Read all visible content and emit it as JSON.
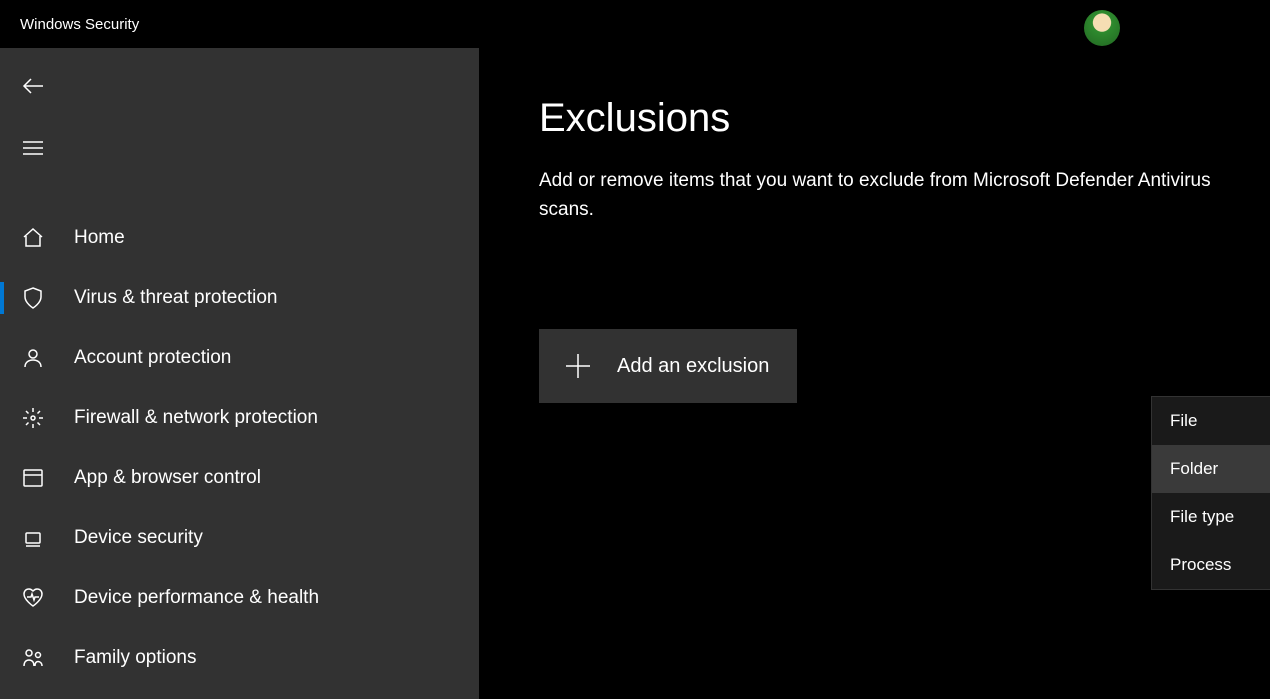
{
  "window": {
    "title": "Windows Security"
  },
  "sidebar": {
    "items": [
      {
        "label": "Home"
      },
      {
        "label": "Virus & threat protection"
      },
      {
        "label": "Account protection"
      },
      {
        "label": "Firewall & network protection"
      },
      {
        "label": "App & browser control"
      },
      {
        "label": "Device security"
      },
      {
        "label": "Device performance & health"
      },
      {
        "label": "Family options"
      }
    ],
    "selectedIndex": 1
  },
  "main": {
    "heading": "Exclusions",
    "description": "Add or remove items that you want to exclude from Microsoft Defender Antivirus scans.",
    "addButton": "Add an exclusion"
  },
  "dropdown": {
    "items": [
      {
        "label": "File"
      },
      {
        "label": "Folder"
      },
      {
        "label": "File type"
      },
      {
        "label": "Process"
      }
    ],
    "hoverIndex": 1
  }
}
